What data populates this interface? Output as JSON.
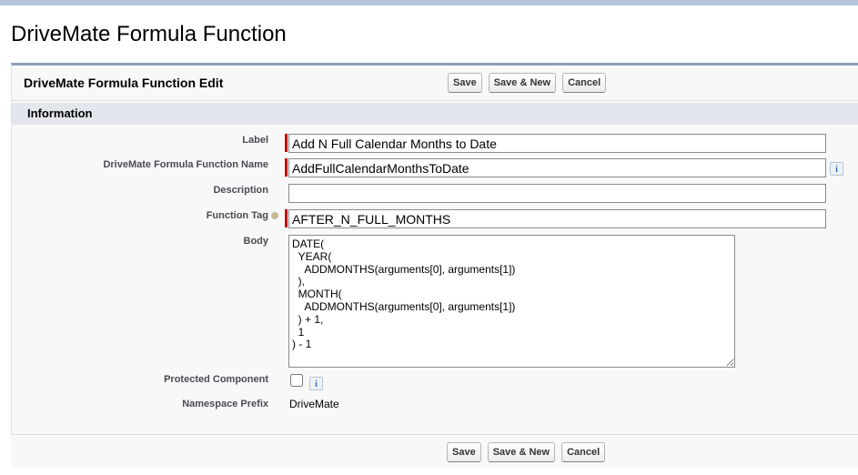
{
  "page": {
    "title": "DriveMate Formula Function"
  },
  "panel": {
    "title": "DriveMate Formula Function Edit",
    "save": "Save",
    "save_new": "Save & New",
    "cancel": "Cancel"
  },
  "section": {
    "title": "Information"
  },
  "fields": {
    "label": {
      "label": "Label",
      "value": "Add N Full Calendar Months to Date"
    },
    "name": {
      "label": "DriveMate Formula Function Name",
      "value": "AddFullCalendarMonthsToDate"
    },
    "description": {
      "label": "Description",
      "value": ""
    },
    "tag": {
      "label": "Function Tag",
      "value": "AFTER_N_FULL_MONTHS"
    },
    "body": {
      "label": "Body",
      "value": "DATE(\n  YEAR(\n    ADDMONTHS(arguments[0], arguments[1])\n  ),\n  MONTH(\n    ADDMONTHS(arguments[0], arguments[1])\n  ) + 1,\n  1\n) - 1"
    },
    "protected": {
      "label": "Protected Component",
      "checked": false
    },
    "namespace": {
      "label": "Namespace Prefix",
      "value": "DriveMate"
    }
  },
  "icons": {
    "info": "i"
  }
}
